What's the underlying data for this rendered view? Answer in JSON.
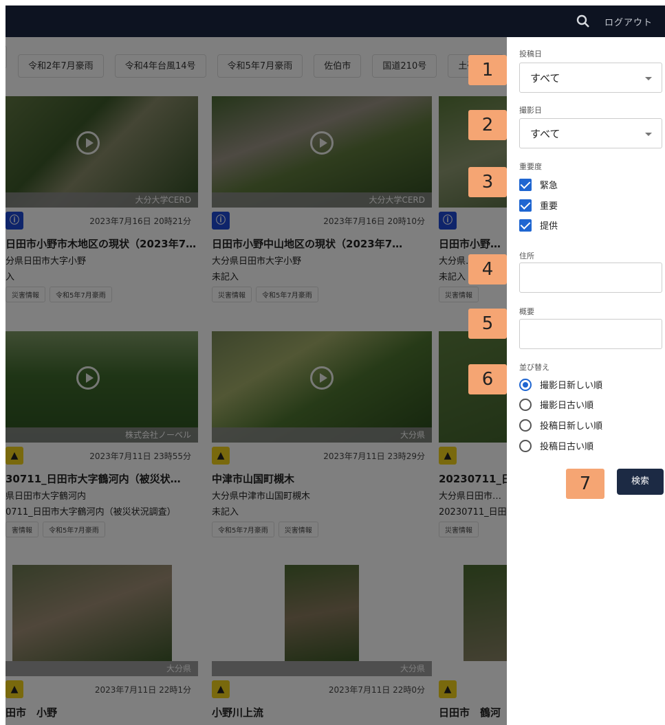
{
  "header": {
    "logout_label": "ログアウト"
  },
  "tags": [
    "令和2年7月豪雨",
    "令和4年台風14号",
    "令和5年7月豪雨",
    "佐伯市",
    "国道210号",
    "土砂崩れ"
  ],
  "cards": [
    {
      "credit": "大分大学CERD",
      "badge": "ⓘ",
      "date": "2023年7月16日 20時21分",
      "title": "日田市小野市木地区の現状（2023年7…",
      "addr": "分県日田市大字小野",
      "sub": "入",
      "tags": [
        "災害情報",
        "令和5年7月豪雨"
      ]
    },
    {
      "credit": "大分大学CERD",
      "badge": "ⓘ",
      "date": "2023年7月16日 20時10分",
      "title": "日田市小野中山地区の現状（2023年7…",
      "addr": "大分県日田市大字小野",
      "sub": "未記入",
      "tags": [
        "災害情報",
        "令和5年7月豪雨"
      ]
    },
    {
      "credit": "",
      "badge": "ⓘ",
      "date": "",
      "title": "日田市小野…",
      "addr": "大分県…",
      "sub": "未記入",
      "tags": [
        "災害情報"
      ]
    },
    {
      "credit": "株式会社ノーベル",
      "badge": "▲",
      "date": "2023年7月11日 23時55分",
      "title": "30711_日田市大字鶴河内（被災状…",
      "addr": "県日田市大字鶴河内",
      "sub": "0711_日田市大字鶴河内（被災状況調査）",
      "tags": [
        "害情報",
        "令和5年7月豪雨"
      ]
    },
    {
      "credit": "大分県",
      "badge": "▲",
      "date": "2023年7月11日 23時29分",
      "title": "中津市山国町槻木",
      "addr": "大分県中津市山国町槻木",
      "sub": "未記入",
      "tags": [
        "令和5年7月豪雨",
        "災害情報"
      ]
    },
    {
      "credit": "",
      "badge": "▲",
      "date": "",
      "title": "20230711_日…",
      "addr": "大分県日田市…",
      "sub": "20230711_日田…",
      "tags": [
        "災害情報"
      ]
    },
    {
      "credit": "大分県",
      "badge": "▲",
      "date": "2023年7月11日 22時1分",
      "title": "田市　小野",
      "addr": "",
      "sub": "",
      "tags": []
    },
    {
      "credit": "大分県",
      "badge": "▲",
      "date": "2023年7月11日 22時0分",
      "title": "小野川上流",
      "addr": "",
      "sub": "",
      "tags": []
    },
    {
      "credit": "",
      "badge": "▲",
      "date": "",
      "title": "日田市　鶴河",
      "addr": "",
      "sub": "",
      "tags": []
    }
  ],
  "filters": {
    "post_date_label": "投稿日",
    "post_date_value": "すべて",
    "shoot_date_label": "撮影日",
    "shoot_date_value": "すべて",
    "importance_label": "重要度",
    "importance_options": [
      "緊急",
      "重要",
      "提供"
    ],
    "address_label": "住所",
    "summary_label": "概要",
    "sort_label": "並び替え",
    "sort_options": [
      "撮影日新しい順",
      "撮影日古い順",
      "投稿日新しい順",
      "投稿日古い順"
    ],
    "search_label": "検索"
  },
  "callouts": [
    "1",
    "2",
    "3",
    "4",
    "5",
    "6",
    "7"
  ],
  "colors": {
    "header_bg": "#0d1321",
    "callout": "#f5a573",
    "accent": "#1f66d1",
    "button": "#1c2a44"
  }
}
